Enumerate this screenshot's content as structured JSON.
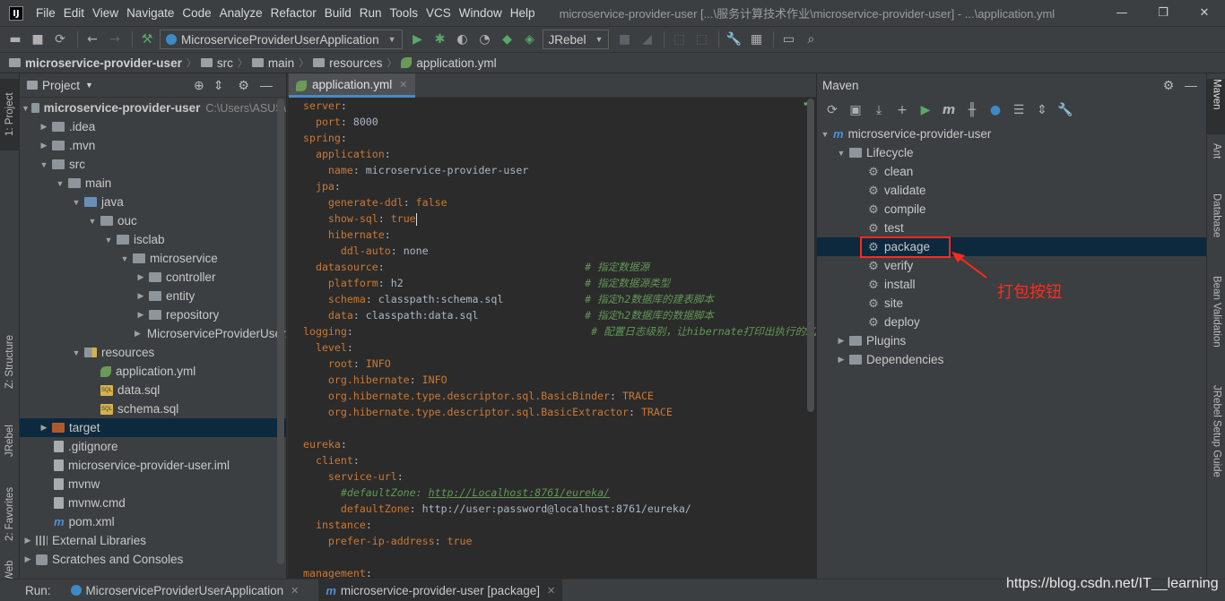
{
  "menubar": {
    "app_icon": "IJ",
    "items": [
      "File",
      "Edit",
      "View",
      "Navigate",
      "Code",
      "Analyze",
      "Refactor",
      "Build",
      "Run",
      "Tools",
      "VCS",
      "Window",
      "Help"
    ],
    "title": "microservice-provider-user [...\\服务计算技术作业\\microservice-provider-user] - ...\\application.yml",
    "controls": [
      "—",
      "❐",
      "✕"
    ]
  },
  "toolbar": {
    "run_config": "MicroserviceProviderUserApplication",
    "jrebel_combo": "JRebel"
  },
  "breadcrumb": [
    "microservice-provider-user",
    "src",
    "main",
    "resources",
    "application.yml"
  ],
  "left_strip": {
    "project_tab": "1: Project",
    "structure_tab": "Z: Structure",
    "jrebel_tab": "JRebel",
    "favorites_tab": "2: Favorites",
    "web_tab": "Web"
  },
  "project": {
    "header": "Project",
    "root": {
      "name": "microservice-provider-user",
      "path": "C:\\Users\\ASUS\\"
    },
    "items": [
      ".idea",
      ".mvn",
      "src",
      "main",
      "java",
      "ouc",
      "isclab",
      "microservice",
      "controller",
      "entity",
      "repository",
      "MicroserviceProviderUserApplication",
      "resources",
      "application.yml",
      "data.sql",
      "schema.sql",
      "target",
      ".gitignore",
      "microservice-provider-user.iml",
      "mvnw",
      "mvnw.cmd",
      "pom.xml",
      "External Libraries",
      "Scratches and Consoles"
    ]
  },
  "editor": {
    "tab": "application.yml",
    "lines": [
      [
        [
          "k",
          "server"
        ],
        [
          "v",
          ":"
        ]
      ],
      [
        [
          "k",
          "  port"
        ],
        [
          "v",
          ": 8000"
        ]
      ],
      [
        [
          "k",
          "spring"
        ],
        [
          "v",
          ":"
        ]
      ],
      [
        [
          "k",
          "  application"
        ],
        [
          "v",
          ":"
        ]
      ],
      [
        [
          "k",
          "    name"
        ],
        [
          "v",
          ": microservice-provider-user"
        ]
      ],
      [
        [
          "k",
          "  jpa"
        ],
        [
          "v",
          ":"
        ]
      ],
      [
        [
          "k",
          "    generate-ddl"
        ],
        [
          "v",
          ": "
        ],
        [
          "k",
          "false"
        ]
      ],
      [
        [
          "k",
          "    show-sql"
        ],
        [
          "v",
          ": "
        ],
        [
          "k",
          "true"
        ]
      ],
      [
        [
          "k",
          "    hibernate"
        ],
        [
          "v",
          ":"
        ]
      ],
      [
        [
          "k",
          "      ddl-auto"
        ],
        [
          "v",
          ": none"
        ]
      ],
      [
        [
          "k",
          "  datasource"
        ],
        [
          "v",
          ":                                "
        ],
        [
          "c",
          "# 指定数据源"
        ]
      ],
      [
        [
          "k",
          "    platform"
        ],
        [
          "v",
          ": h2                             "
        ],
        [
          "c",
          "# 指定数据源类型"
        ]
      ],
      [
        [
          "k",
          "    schema"
        ],
        [
          "v",
          ": classpath:schema.sql             "
        ],
        [
          "c",
          "# 指定h2数据库的建表脚本"
        ]
      ],
      [
        [
          "k",
          "    data"
        ],
        [
          "v",
          ": classpath:data.sql                 "
        ],
        [
          "c",
          "# 指定h2数据库的数据脚本"
        ]
      ],
      [
        [
          "k",
          "logging"
        ],
        [
          "v",
          ":                                      "
        ],
        [
          "c",
          "# 配置日志级别，让hibernate打印出执行的SQL"
        ]
      ],
      [
        [
          "k",
          "  level"
        ],
        [
          "v",
          ":"
        ]
      ],
      [
        [
          "k",
          "    root"
        ],
        [
          "v",
          ": "
        ],
        [
          "k",
          "INFO"
        ]
      ],
      [
        [
          "k",
          "    org.hibernate"
        ],
        [
          "v",
          ": "
        ],
        [
          "k",
          "INFO"
        ]
      ],
      [
        [
          "k",
          "    org.hibernate.type.descriptor.sql.BasicBinder"
        ],
        [
          "v",
          ": "
        ],
        [
          "k",
          "TRACE"
        ]
      ],
      [
        [
          "k",
          "    org.hibernate.type.descriptor.sql.BasicExtractor"
        ],
        [
          "v",
          ": "
        ],
        [
          "k",
          "TRACE"
        ]
      ],
      [],
      [
        [
          "k",
          "eureka"
        ],
        [
          "v",
          ":"
        ]
      ],
      [
        [
          "k",
          "  client"
        ],
        [
          "v",
          ":"
        ]
      ],
      [
        [
          "k",
          "    service-url"
        ],
        [
          "v",
          ":"
        ]
      ],
      [
        [
          "c",
          "      #defaultZone: "
        ],
        [
          "cu",
          "http://Localhost:8761/eureka/"
        ]
      ],
      [
        [
          "k",
          "      defaultZone"
        ],
        [
          "v",
          ": http://user:password@localhost:8761/eureka/"
        ]
      ],
      [
        [
          "k",
          "  instance"
        ],
        [
          "v",
          ":"
        ]
      ],
      [
        [
          "k",
          "    prefer-ip-address"
        ],
        [
          "v",
          ": "
        ],
        [
          "k",
          "true"
        ]
      ],
      [],
      [
        [
          "k",
          "management"
        ],
        [
          "v",
          ":"
        ]
      ]
    ]
  },
  "maven": {
    "header": "Maven",
    "root": "microservice-provider-user",
    "lifecycle": "Lifecycle",
    "phases": [
      "clean",
      "validate",
      "compile",
      "test",
      "package",
      "verify",
      "install",
      "site",
      "deploy"
    ],
    "plugins": "Plugins",
    "dependencies": "Dependencies",
    "selected": "package"
  },
  "annotation": {
    "callout": "打包按钮",
    "color": "#ff2a1c"
  },
  "right_strip": {
    "maven_tab": "Maven",
    "ant_tab": "Ant",
    "database_tab": "Database",
    "bean_tab": "Bean Validation",
    "jrebel_tab": "JRebel Setup Guide"
  },
  "runbar": {
    "label": "Run:",
    "tab1": "MicroserviceProviderUserApplication",
    "tab2": "microservice-provider-user [package]"
  },
  "watermark": "https://blog.csdn.net/IT__learning",
  "colors": {
    "accent": "#4a88c7",
    "selection": "#0d293e",
    "keyword": "#cc7832",
    "comment": "#629755",
    "green": "#59a869"
  }
}
